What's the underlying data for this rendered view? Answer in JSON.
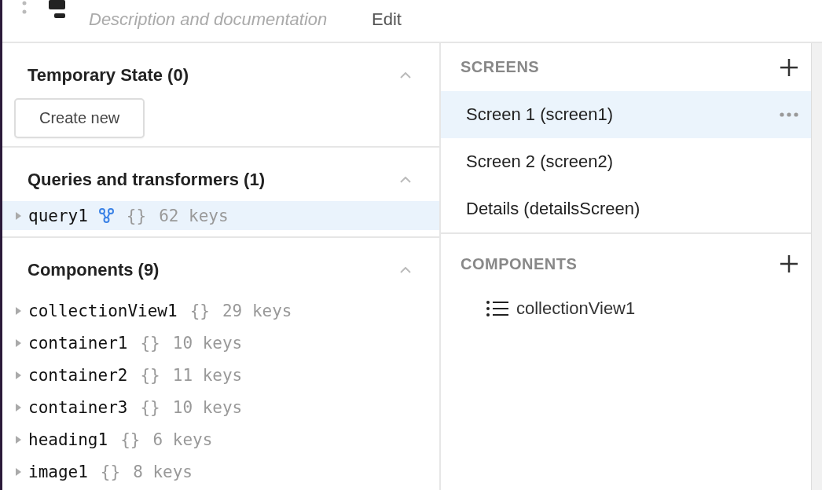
{
  "header": {
    "description": {
      "placeholder": "Description and documentation"
    },
    "edit_link": "Edit"
  },
  "temporary_state": {
    "title": "Temporary State (0)",
    "expanded": true,
    "create_button": "Create new"
  },
  "queries": {
    "title": "Queries and transformers (1)",
    "expanded": true,
    "items": [
      {
        "name": "query1",
        "kind": "query",
        "selected": true,
        "brace": "{}",
        "count": "62 keys"
      }
    ]
  },
  "components": {
    "title": "Components (9)",
    "expanded": true,
    "items": [
      {
        "name": "collectionView1",
        "selected": false,
        "brace": "{}",
        "count": "29 keys"
      },
      {
        "name": "container1",
        "selected": false,
        "brace": "{}",
        "count": "10 keys"
      },
      {
        "name": "container2",
        "selected": false,
        "brace": "{}",
        "count": "11 keys"
      },
      {
        "name": "container3",
        "selected": false,
        "brace": "{}",
        "count": "10 keys"
      },
      {
        "name": "heading1",
        "selected": false,
        "brace": "{}",
        "count": "6 keys"
      },
      {
        "name": "image1",
        "selected": false,
        "brace": "{}",
        "count": "8 keys"
      }
    ]
  },
  "screens": {
    "title": "SCREENS",
    "items": [
      {
        "label": "Screen 1 (screen1)",
        "selected": true
      },
      {
        "label": "Screen 2 (screen2)",
        "selected": false
      },
      {
        "label": "Details (detailsScreen)",
        "selected": false
      }
    ]
  },
  "screen_components": {
    "title": "COMPONENTS",
    "items": [
      {
        "name": "collectionView1",
        "kind": "list"
      }
    ]
  }
}
